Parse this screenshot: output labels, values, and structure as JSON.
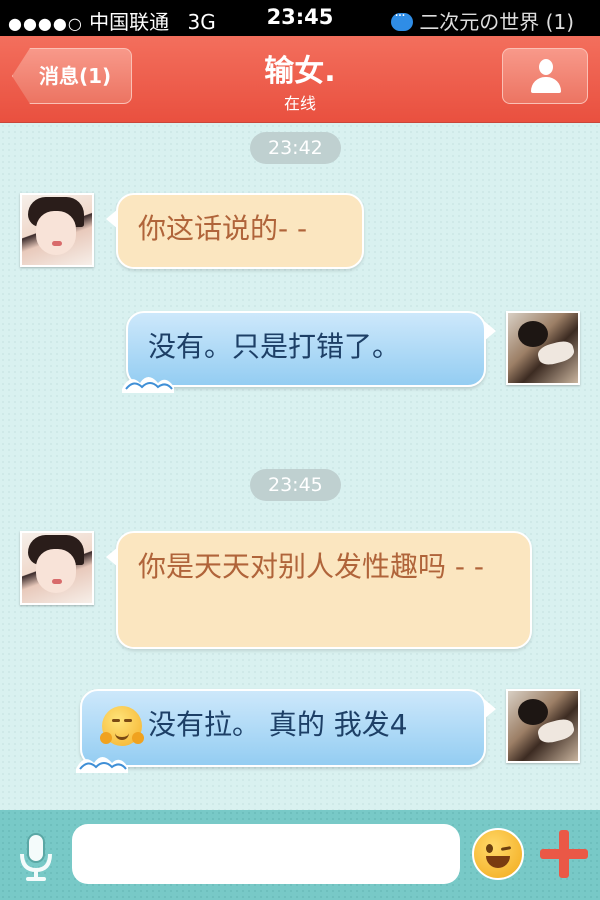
{
  "status_bar": {
    "signal": "●●●●○",
    "carrier": "中国联通",
    "network": "3G",
    "time": "23:45",
    "notification": "二次元の世界 (1)"
  },
  "nav": {
    "back_label": "消息(1)",
    "title": "输女.",
    "subtitle": "在线"
  },
  "chat": {
    "groups": [
      {
        "timestamp": "23:42",
        "messages": [
          {
            "direction": "incoming",
            "text": "你这话说的- -"
          },
          {
            "direction": "outgoing",
            "text": "没有。只是打错了。"
          }
        ]
      },
      {
        "timestamp": "23:45",
        "messages": [
          {
            "direction": "incoming",
            "text": "你是天天对别人发性趣吗 - -"
          },
          {
            "direction": "outgoing",
            "text": "没有拉。 真的 我发4",
            "emoji": "blushing-face"
          }
        ]
      }
    ]
  },
  "input": {
    "value": "",
    "placeholder": ""
  },
  "colors": {
    "nav": "#ec5b49",
    "chat_bg": "#d9f1f0",
    "incoming_bubble": "#fbe6c0",
    "outgoing_bubble": "#a9d7f5",
    "input_bar": "#78c9c7"
  }
}
